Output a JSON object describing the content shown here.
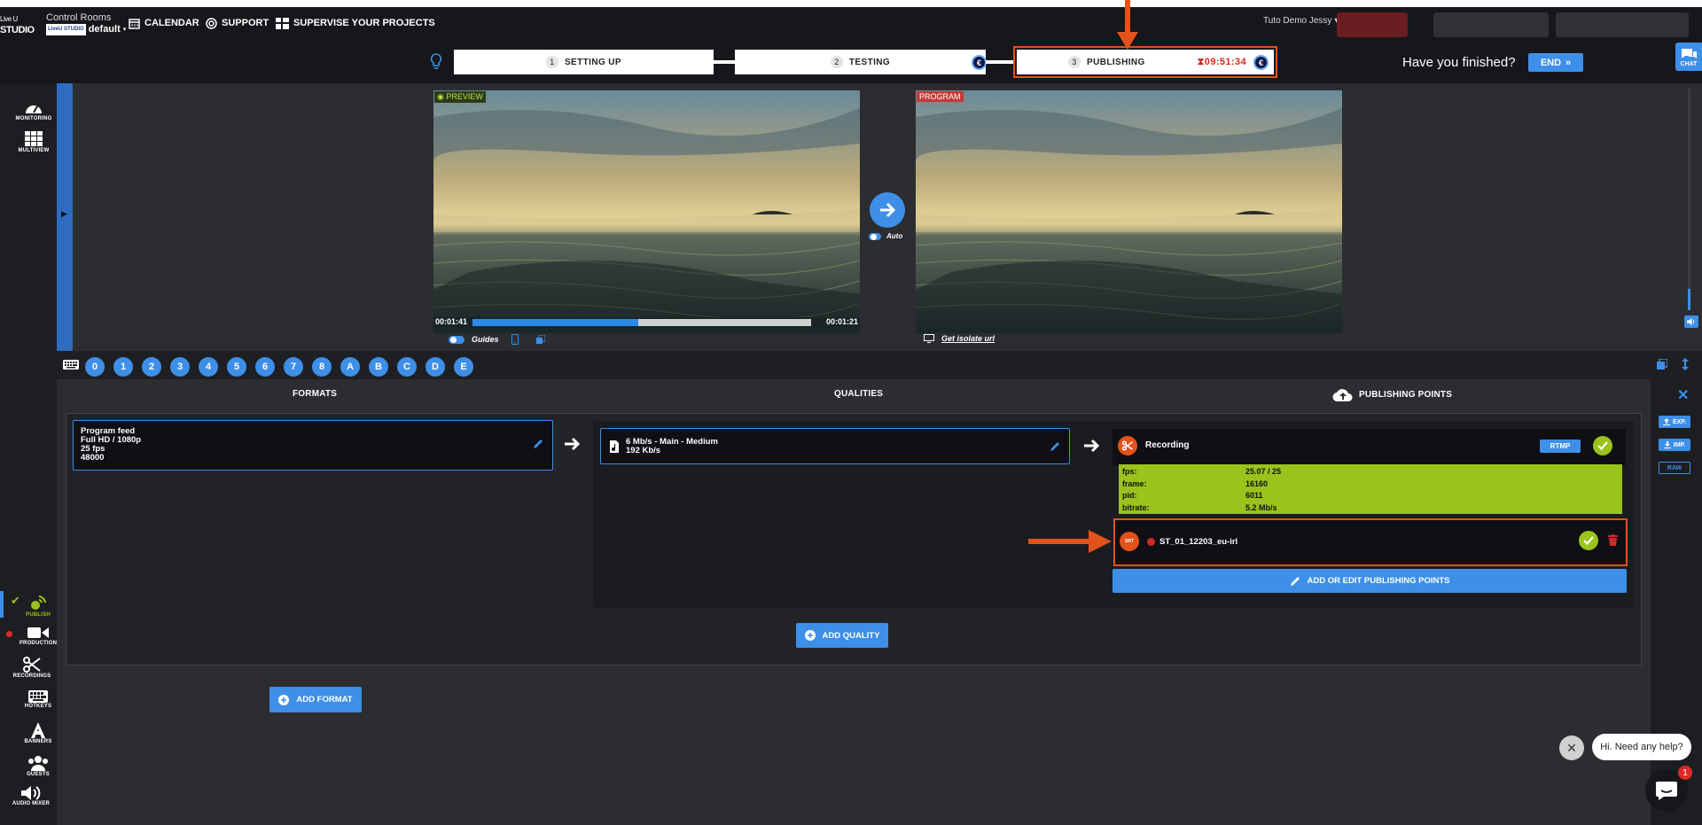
{
  "logo": {
    "line1": "Live U",
    "line2": "STUDIO"
  },
  "header": {
    "app_name": "Control Rooms",
    "workspace_logo": "LiveU STUDIO",
    "workspace": "default",
    "nav": [
      {
        "label": "CALENDAR",
        "icon": "calendar-icon"
      },
      {
        "label": "SUPPORT",
        "icon": "lifebuoy-icon"
      },
      {
        "label": "SUPERVISE YOUR PROJECTS",
        "icon": "grid-icon"
      }
    ],
    "user": "Tuto Demo Jessy"
  },
  "steps": [
    {
      "num": "1",
      "label": "SETTING UP"
    },
    {
      "num": "2",
      "label": "TESTING"
    },
    {
      "num": "3",
      "label": "PUBLISHING",
      "timer": "09:51:34"
    }
  ],
  "euro_symbol": "€",
  "finish": {
    "question": "Have you finished?",
    "end_label": "END"
  },
  "chat_label": "CHAT",
  "left_nav_top": [
    {
      "label": "MONITORING",
      "icon": "gauge-icon"
    },
    {
      "label": "MULTIVIEW",
      "icon": "grid-icon"
    }
  ],
  "left_nav_bottom": [
    {
      "label": "PUBLISH",
      "icon": "broadcast-icon"
    },
    {
      "label": "PRODUCTION",
      "icon": "camera-icon"
    },
    {
      "label": "RECORDINGS",
      "icon": "scissors-icon"
    },
    {
      "label": "HOTKEYS",
      "icon": "keyboard-icon"
    },
    {
      "label": "BANNERS",
      "icon": "letter-a-icon"
    },
    {
      "label": "GUESTS",
      "icon": "users-icon"
    },
    {
      "label": "AUDIO MIXER",
      "icon": "speaker-icon"
    }
  ],
  "preview": {
    "tag": "PREVIEW",
    "time_left": "00:01:41",
    "time_right": "00:01:21",
    "progress": 0.49,
    "guides_label": "Guides"
  },
  "program": {
    "tag": "PROGRAM",
    "isolate_label": "Get isolate url"
  },
  "auto_label": "Auto",
  "scenes": [
    "0",
    "1",
    "2",
    "3",
    "4",
    "5",
    "6",
    "7",
    "8",
    "A",
    "B",
    "C",
    "D",
    "E"
  ],
  "columns": {
    "formats": "FORMATS",
    "qualities": "QUALITIES",
    "publishing": "PUBLISHING POINTS"
  },
  "format": {
    "line1": "Program feed",
    "line2": "Full HD / 1080p",
    "line3": "25 fps",
    "line4": "48000"
  },
  "quality": {
    "line1": "6 Mb/s  -  Main  -  Medium",
    "line2": "192 Kb/s"
  },
  "publishing_point": {
    "name": "Recording",
    "protocol": "RTMP",
    "stats": [
      {
        "key": "fps:",
        "value": "25.07 / 25"
      },
      {
        "key": "frame:",
        "value": "16160"
      },
      {
        "key": "pid:",
        "value": "6011"
      },
      {
        "key": "bitrate:",
        "value": "5.2 Mb/s"
      }
    ]
  },
  "srt": {
    "badge": "SRT",
    "name": "ST_01_12203_eu-irl"
  },
  "buttons": {
    "add_edit_pub": "ADD OR EDIT PUBLISHING POINTS",
    "add_quality": "ADD QUALITY",
    "add_format": "ADD FORMAT"
  },
  "right_tools": {
    "exp": "EXP.",
    "imp": "IMP.",
    "raw": "RAW"
  },
  "help": {
    "text": "Hi. Need any help?",
    "badge": "1"
  },
  "colors": {
    "accent": "#3d8fe8",
    "highlight": "#e2521b",
    "ok": "#9ac31c"
  }
}
